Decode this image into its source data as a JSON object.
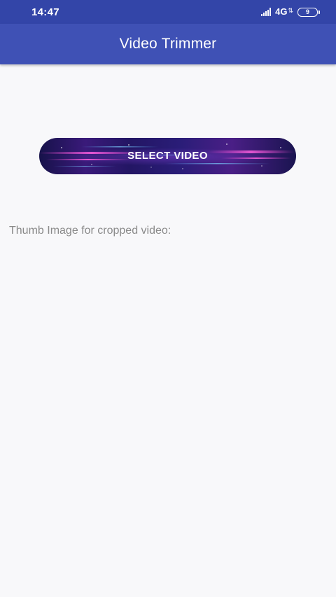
{
  "status_bar": {
    "time": "14:47",
    "network": "4G",
    "battery_level": "9",
    "background_color": "#3345a8",
    "icons": [
      "signal-icon",
      "data-arrows-icon",
      "battery-icon"
    ]
  },
  "app_bar": {
    "title": "Video Trimmer",
    "background_color": "#3f51b5"
  },
  "main": {
    "select_button_label": "SELECT VIDEO",
    "thumb_label": "Thumb Image for cropped video:"
  }
}
